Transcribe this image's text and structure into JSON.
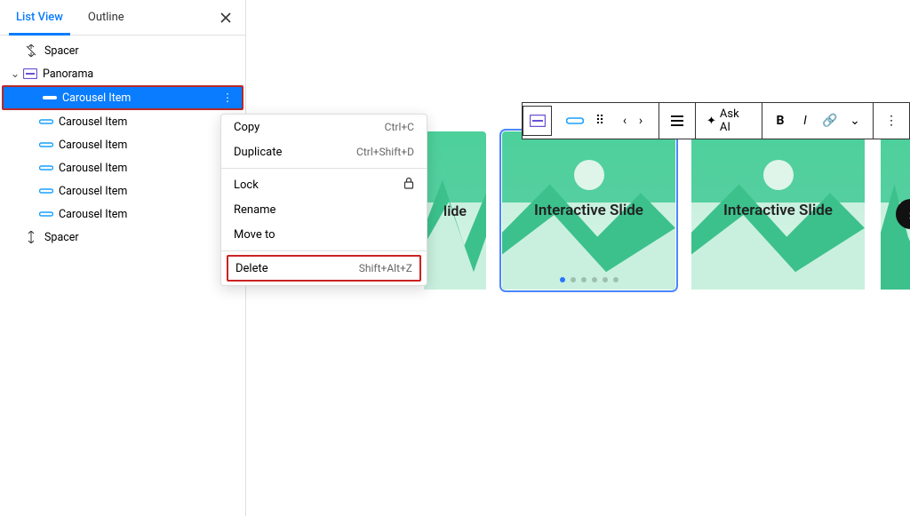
{
  "tabs": {
    "list_view": "List View",
    "outline": "Outline"
  },
  "tree": {
    "spacer": "Spacer",
    "panorama": "Panorama",
    "carousel_item": "Carousel Item"
  },
  "context_menu": {
    "copy": "Copy",
    "copy_sc": "Ctrl+C",
    "duplicate": "Duplicate",
    "duplicate_sc": "Ctrl+Shift+D",
    "lock": "Lock",
    "rename": "Rename",
    "move_to": "Move to",
    "delete": "Delete",
    "delete_sc": "Shift+Alt+Z"
  },
  "toolbar": {
    "ask_ai": "Ask AI"
  },
  "slide": {
    "title": "Interactive Slide",
    "title_partial": "lide"
  }
}
